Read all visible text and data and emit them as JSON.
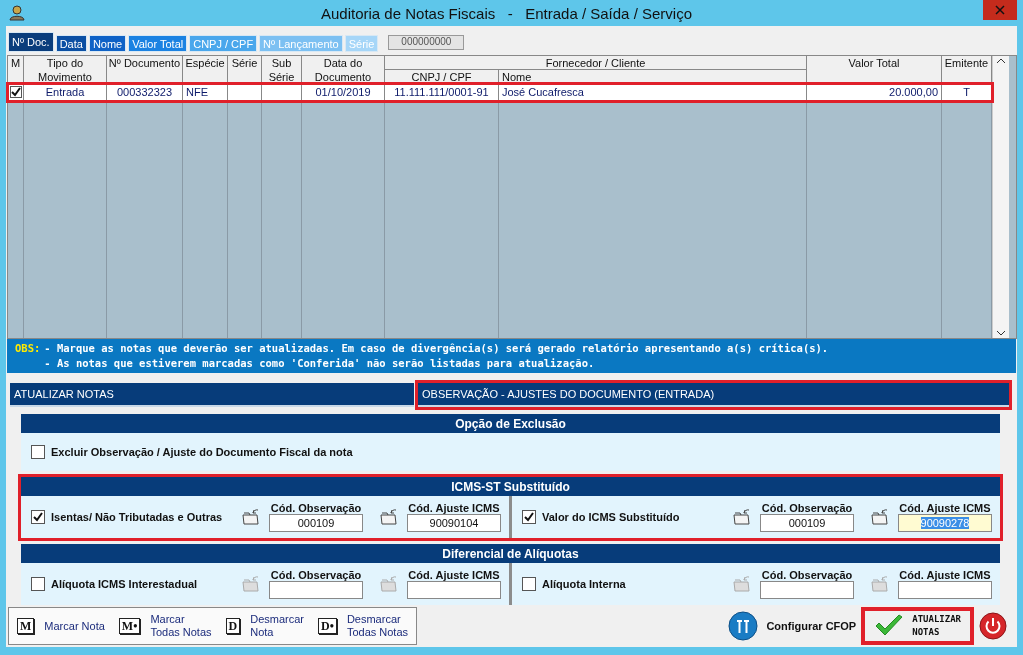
{
  "window": {
    "title": "Auditoria de Notas Fiscais   -   Entrada / Saída / Serviço"
  },
  "sort_tabs": [
    {
      "label": "Nº Doc.",
      "selected": true
    },
    {
      "label": "Data",
      "selected": false
    },
    {
      "label": "Nome",
      "selected": false
    },
    {
      "label": "Valor Total",
      "selected": false
    },
    {
      "label": "CNPJ / CPF",
      "selected": false
    },
    {
      "label": "Nº Lançamento",
      "selected": false
    },
    {
      "label": "Série",
      "selected": false
    }
  ],
  "search_field": {
    "value": "000000000"
  },
  "table": {
    "columns": [
      {
        "label": "M"
      },
      {
        "label": "Tipo do",
        "label_2": "Movimento"
      },
      {
        "label": "Nº Documento"
      },
      {
        "label": "Espécie"
      },
      {
        "label": "Série"
      },
      {
        "label": "Sub",
        "label_2": "Série"
      },
      {
        "label": "Data do",
        "label_2": "Documento"
      },
      {
        "label": "Fornecedor / Cliente",
        "label_2": "CNPJ / CPF"
      },
      {
        "label_2": "Nome"
      },
      {
        "label": "Valor Total"
      },
      {
        "label": "Emitente"
      }
    ],
    "rows": [
      {
        "marked": true,
        "highlighted": true,
        "cells": [
          "",
          "Entrada",
          "000332323",
          "NFE",
          "",
          "",
          "01/10/2019",
          "11.111.111/0001-91",
          "José Cucafresca",
          "20.000,00",
          "T"
        ]
      }
    ]
  },
  "notice": {
    "label": "OBS:",
    "lines": [
      "- Marque as notas que deverão ser atualizadas. Em caso de divergência(s) será gerado relatório apresentando a(s) crítica(s).",
      "- As notas que estiverem marcadas como 'Conferida' não serão listadas para atualização."
    ]
  },
  "panel_tabs": [
    {
      "label": "ATUALIZAR NOTAS",
      "highlighted": false
    },
    {
      "label": "OBSERVAÇÃO - AJUSTES DO DOCUMENTO (ENTRADA)",
      "highlighted": true
    }
  ],
  "sections": [
    {
      "title": "Opção de Exclusão",
      "highlighted": false,
      "options": [
        {
          "kind": "plain",
          "label": "Excluir Observação / Ajuste do Documento Fiscal da nota",
          "checked": false
        }
      ]
    },
    {
      "title": "ICMS-ST Substituído",
      "highlighted": true,
      "options": [
        {
          "kind": "codes",
          "label": "Isentas/ Não Tributadas e Outras",
          "checked": true,
          "enabled": true,
          "fields": [
            {
              "label": "Cód. Observação",
              "value": "000109",
              "focused": false
            },
            {
              "label": "Cód. Ajuste ICMS",
              "value": "90090104",
              "focused": false
            }
          ]
        },
        {
          "kind": "codes",
          "label": "Valor do ICMS Substituído",
          "checked": true,
          "enabled": true,
          "fields": [
            {
              "label": "Cód. Observação",
              "value": "000109",
              "focused": false
            },
            {
              "label": "Cód. Ajuste ICMS",
              "value": "90090278",
              "focused": true
            }
          ]
        }
      ]
    },
    {
      "title": "Diferencial de Alíquotas",
      "highlighted": false,
      "options": [
        {
          "kind": "codes",
          "label": "Alíquota ICMS Interestadual",
          "checked": false,
          "enabled": false,
          "fields": [
            {
              "label": "Cód. Observação",
              "focused": false
            },
            {
              "label": "Cód. Ajuste ICMS",
              "focused": false
            }
          ]
        },
        {
          "kind": "codes",
          "label": "Alíquota Interna",
          "checked": false,
          "enabled": false,
          "fields": [
            {
              "label": "Cód. Observação",
              "focused": false
            },
            {
              "label": "Cód. Ajuste ICMS",
              "focused": false
            }
          ]
        }
      ]
    }
  ],
  "actions": [
    {
      "key": "M",
      "label": "Marcar Nota"
    },
    {
      "key": "M•",
      "label": "Marcar\nTodas Notas"
    },
    {
      "key": "D",
      "label": "Desmarcar\nNota"
    },
    {
      "key": "D•",
      "label": "Desmarcar\nTodas Notas"
    }
  ],
  "cfop_button": {
    "label": "Configurar CFOP"
  },
  "update_button": {
    "label": "ATUALIZAR\nNOTAS",
    "highlighted": true
  }
}
